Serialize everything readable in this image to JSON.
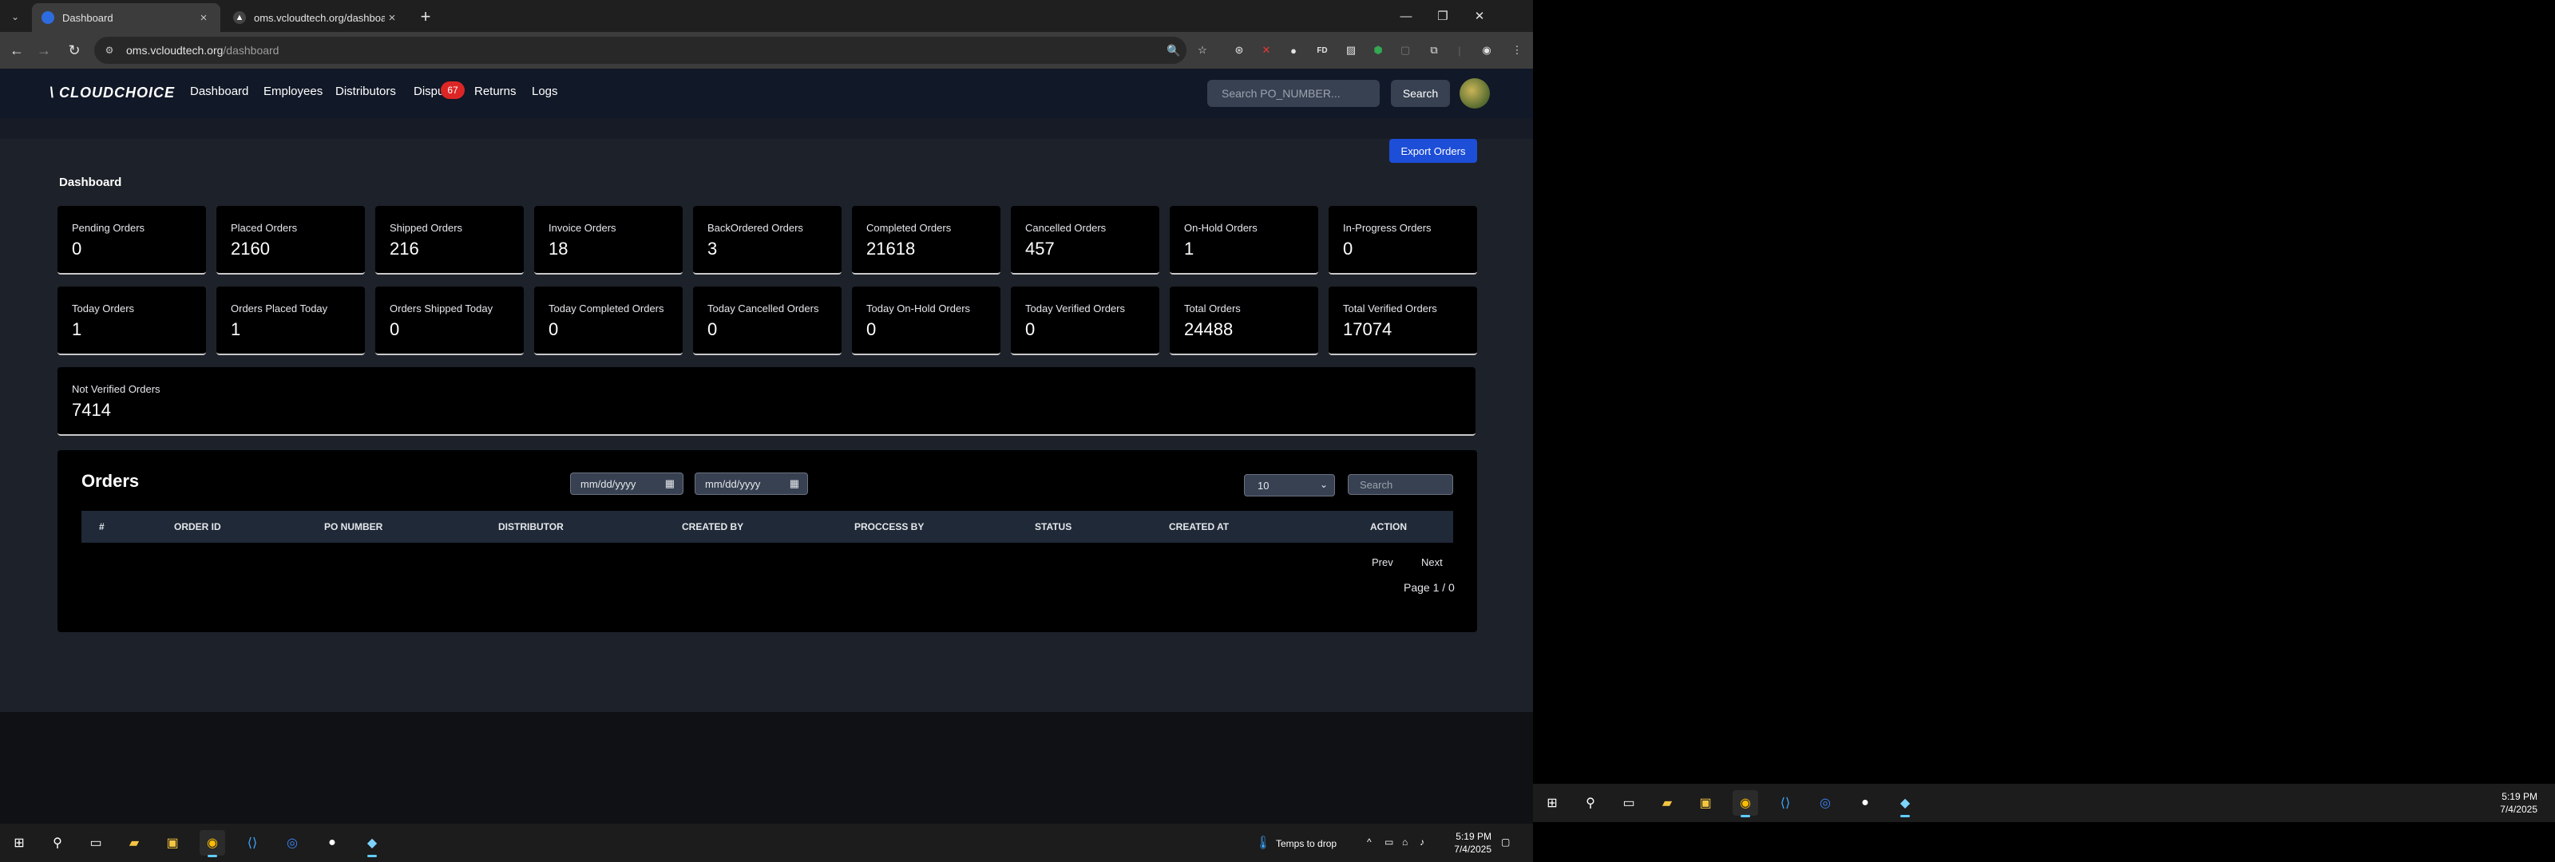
{
  "browser": {
    "tabs": [
      {
        "title": "Dashboard",
        "active": true
      },
      {
        "title": "oms.vcloudtech.org/dashboard",
        "active": false
      }
    ],
    "url_host": "oms.vcloudtech.org",
    "url_path": "/dashboard"
  },
  "app": {
    "logo": "\\ CLOUDCHOICE",
    "nav": [
      "Dashboard",
      "Employees",
      "Distributors",
      "Dispu",
      "Returns",
      "Logs"
    ],
    "disputes_badge": "67",
    "search_placeholder": "Search PO_NUMBER...",
    "search_button": "Search"
  },
  "dashboard": {
    "export_label": "Export Orders",
    "title": "Dashboard",
    "row1": [
      {
        "label": "Pending Orders",
        "value": "0"
      },
      {
        "label": "Placed Orders",
        "value": "2160"
      },
      {
        "label": "Shipped Orders",
        "value": "216"
      },
      {
        "label": "Invoice Orders",
        "value": "18"
      },
      {
        "label": "BackOrdered Orders",
        "value": "3"
      },
      {
        "label": "Completed Orders",
        "value": "21618"
      },
      {
        "label": "Cancelled Orders",
        "value": "457"
      },
      {
        "label": "On-Hold Orders",
        "value": "1"
      },
      {
        "label": "In-Progress Orders",
        "value": "0"
      }
    ],
    "row2": [
      {
        "label": "Today Orders",
        "value": "1"
      },
      {
        "label": "Orders Placed Today",
        "value": "1"
      },
      {
        "label": "Orders Shipped Today",
        "value": "0"
      },
      {
        "label": "Today Completed Orders",
        "value": "0"
      },
      {
        "label": "Today Cancelled Orders",
        "value": "0"
      },
      {
        "label": "Today On-Hold Orders",
        "value": "0"
      },
      {
        "label": "Today Verified Orders",
        "value": "0"
      },
      {
        "label": "Total Orders",
        "value": "24488"
      },
      {
        "label": "Total Verified Orders",
        "value": "17074"
      }
    ],
    "not_verified": {
      "label": "Not Verified Orders",
      "value": "7414"
    }
  },
  "orders": {
    "title": "Orders",
    "date_from": "mm/dd/yyyy",
    "date_to": "mm/dd/yyyy",
    "page_size": "10",
    "search_placeholder": "Search",
    "columns": [
      "#",
      "ORDER ID",
      "PO NUMBER",
      "DISTRIBUTOR",
      "CREATED BY",
      "PROCCESS BY",
      "STATUS",
      "CREATED AT",
      "ACTION"
    ],
    "prev": "Prev",
    "next": "Next",
    "page_info": "Page 1 / 0"
  },
  "taskbar_left": {
    "tray_text": "Temps to drop",
    "time": "5:19 PM",
    "date": "7/4/2025"
  },
  "taskbar_right": {
    "time": "5:19 PM",
    "date": "7/4/2025"
  }
}
